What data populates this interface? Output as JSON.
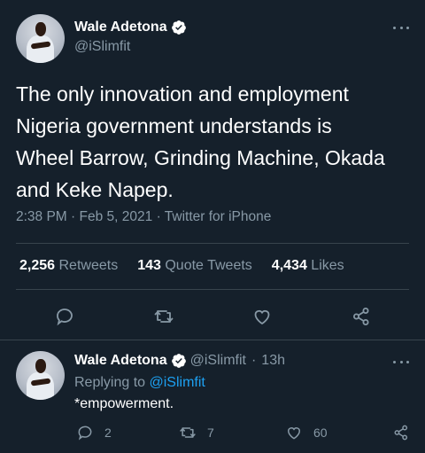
{
  "colors": {
    "background": "#15202b",
    "text": "#ffffff",
    "muted": "#8899a6",
    "accent": "#1da1f2",
    "divider": "#38444d"
  },
  "main_tweet": {
    "display_name": "Wale Adetona",
    "handle": "@iSlimfit",
    "verified_icon": "verified-badge-icon",
    "text_lines": [
      "The only innovation and employment",
      "Nigeria government understands is",
      "Wheel Barrow, Grinding Machine, Okada",
      "and Keke Napep."
    ],
    "time": "2:38 PM",
    "date": "Feb 5, 2021",
    "source": "Twitter for iPhone",
    "stats": {
      "retweets_count": "2,256",
      "retweets_label": "Retweets",
      "quotes_count": "143",
      "quotes_label": "Quote Tweets",
      "likes_count": "4,434",
      "likes_label": "Likes"
    },
    "actions": [
      "reply-icon",
      "retweet-icon",
      "like-icon",
      "share-icon"
    ]
  },
  "reply_tweet": {
    "display_name": "Wale Adetona",
    "handle": "@iSlimfit",
    "time_ago": "13h",
    "replying_prefix": "Replying to",
    "replying_to": "@iSlimfit",
    "text": "*empowerment.",
    "reply_count": "2",
    "retweet_count": "7",
    "like_count": "60"
  }
}
